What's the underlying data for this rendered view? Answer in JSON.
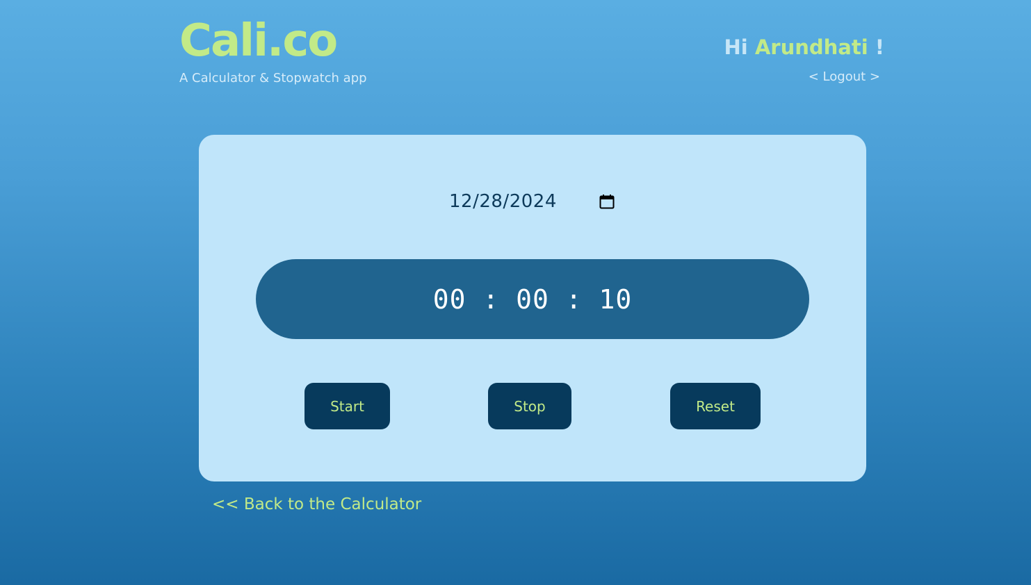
{
  "header": {
    "logo": "Cali.co",
    "tagline": "A Calculator & Stopwatch app",
    "greeting_prefix": "Hi",
    "user_name": "Arundhati",
    "greeting_suffix": "!",
    "logout_label": "< Logout >"
  },
  "stopwatch": {
    "date": "12/28/2024",
    "time": "00 : 00 : 10",
    "start_label": "Start",
    "stop_label": "Stop",
    "reset_label": "Reset"
  },
  "footer": {
    "back_label": "<< Back to the Calculator"
  },
  "colors": {
    "accent_green": "#c2ea88",
    "card_bg": "#c0e5fa",
    "timer_bg": "#20648f",
    "button_bg": "#073a5c"
  },
  "icons": {
    "date_picker": "calendar-icon"
  }
}
